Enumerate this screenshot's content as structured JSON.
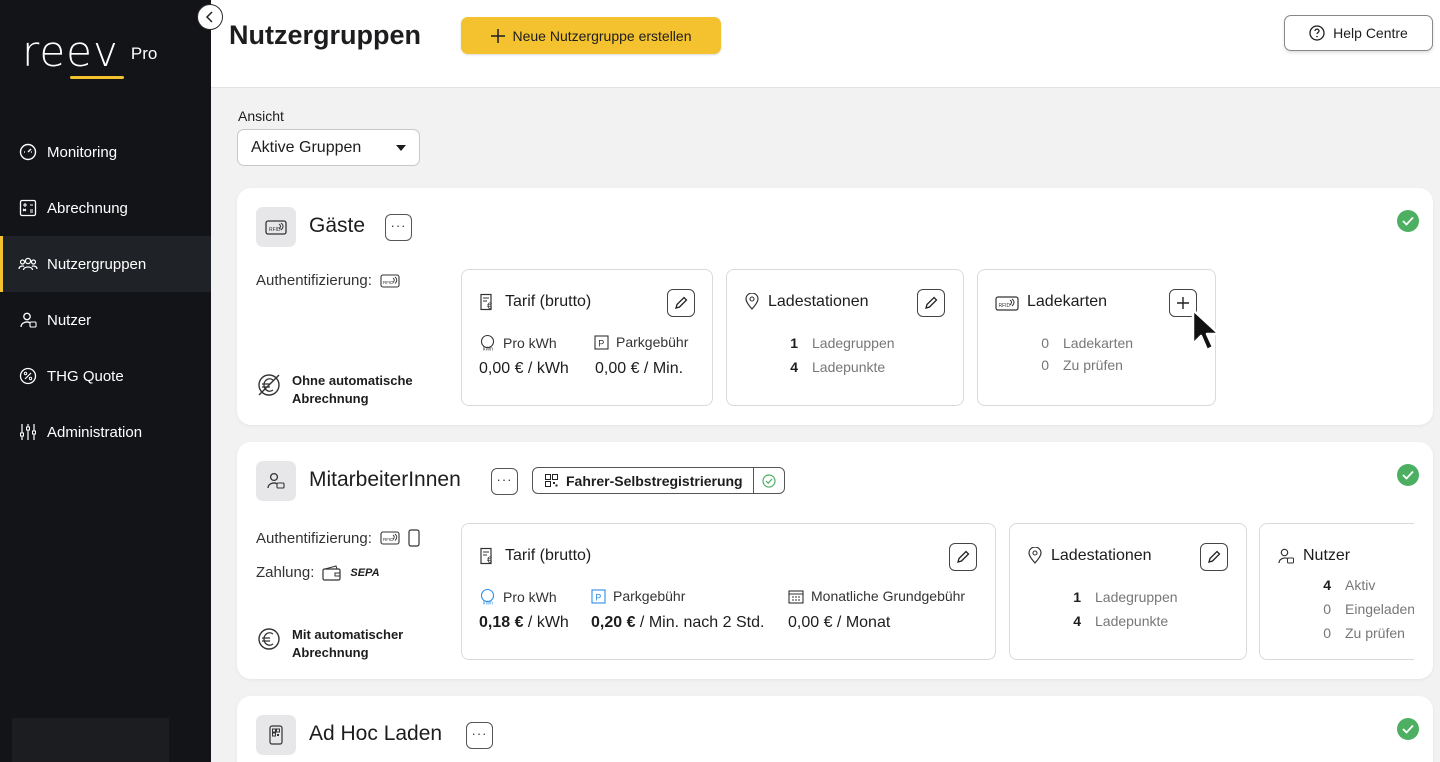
{
  "brand": {
    "logo": "reev",
    "suffix": "Pro",
    "accent": "#f4c22f"
  },
  "sidebar": {
    "items": [
      {
        "label": "Monitoring",
        "icon": "gauge-icon"
      },
      {
        "label": "Abrechnung",
        "icon": "calculator-icon"
      },
      {
        "label": "Nutzergruppen",
        "icon": "users-group-icon",
        "active": true
      },
      {
        "label": "Nutzer",
        "icon": "user-icon"
      },
      {
        "label": "THG Quote",
        "icon": "percent-icon"
      },
      {
        "label": "Administration",
        "icon": "sliders-icon"
      }
    ]
  },
  "header": {
    "title": "Nutzergruppen",
    "new_button": "Neue Nutzergruppe erstellen",
    "help_button": "Help Centre"
  },
  "view": {
    "label": "Ansicht",
    "selected": "Aktive Gruppen"
  },
  "groups": [
    {
      "name": "Gäste",
      "auth_label": "Authentifizierung:",
      "billing": "Ohne automatische Abrechnung",
      "tariff": {
        "title": "Tarif (brutto)",
        "per_kwh_label": "Pro kWh",
        "per_kwh_value": "0,00 € / kWh",
        "parking_label": "Parkgebühr",
        "parking_value": "0,00 € / Min."
      },
      "stations": {
        "title": "Ladestationen",
        "groups_count": "1",
        "groups_label": "Ladegruppen",
        "points_count": "4",
        "points_label": "Ladepunkte"
      },
      "cards": {
        "title": "Ladekarten",
        "cards_count": "0",
        "cards_label": "Ladekarten",
        "check_count": "0",
        "check_label": "Zu prüfen"
      }
    },
    {
      "name": "MitarbeiterInnen",
      "badge": "Fahrer-Selbstregistrierung",
      "auth_label": "Authentifizierung:",
      "payment_label": "Zahlung:",
      "payment_method": "SEPA",
      "billing": "Mit automatischer Abrechnung",
      "tariff": {
        "title": "Tarif (brutto)",
        "per_kwh_label": "Pro kWh",
        "per_kwh_amount": "0,18 €",
        "per_kwh_unit": " / kWh",
        "parking_label": "Parkgebühr",
        "parking_amount": "0,20 €",
        "parking_unit": " / Min. nach 2 Std.",
        "monthly_label": "Monatliche Grundgebühr",
        "monthly_value": "0,00 € / Monat"
      },
      "stations": {
        "title": "Ladestationen",
        "groups_count": "1",
        "groups_label": "Ladegruppen",
        "points_count": "4",
        "points_label": "Ladepunkte"
      },
      "users": {
        "title": "Nutzer",
        "active_count": "4",
        "active_label": "Aktiv",
        "invited_count": "0",
        "invited_label": "Eingeladen",
        "check_count": "0",
        "check_label": "Zu prüfen"
      }
    },
    {
      "name": "Ad Hoc Laden"
    }
  ]
}
